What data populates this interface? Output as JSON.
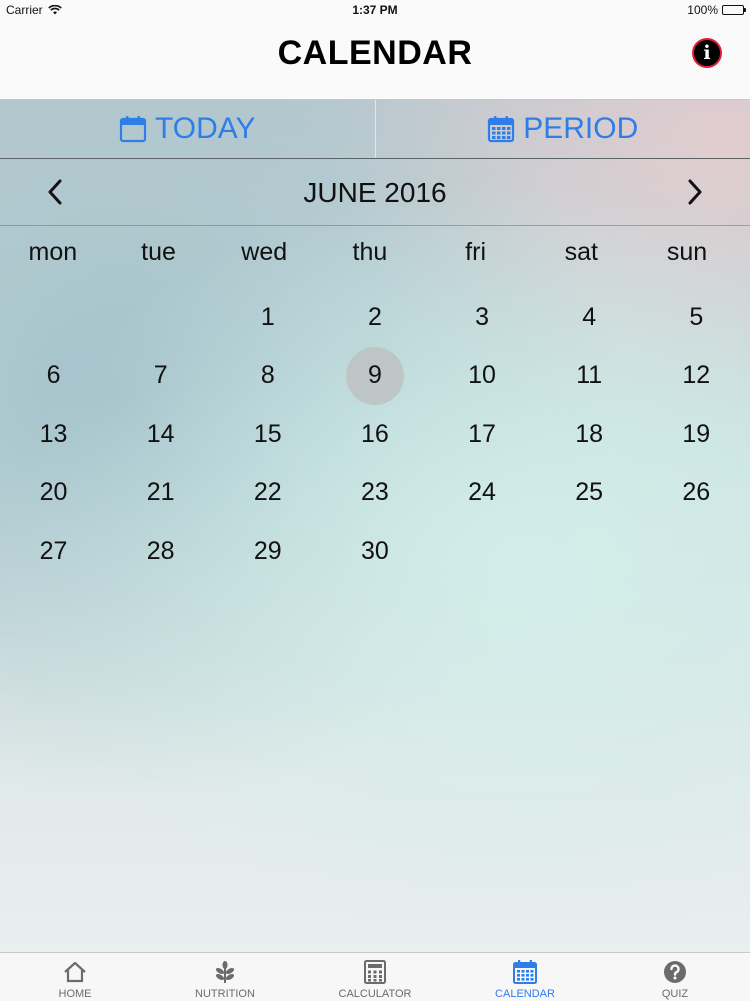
{
  "status_bar": {
    "carrier": "Carrier",
    "time": "1:37 PM",
    "battery": "100%"
  },
  "nav": {
    "title": "CALENDAR",
    "info_glyph": "i"
  },
  "segments": [
    {
      "label": "TODAY",
      "icon": "calendar-icon"
    },
    {
      "label": "PERIOD",
      "icon": "calendar-grid-icon"
    }
  ],
  "calendar": {
    "month_label": "JUNE 2016",
    "weekdays": [
      "mon",
      "tue",
      "wed",
      "thu",
      "fri",
      "sat",
      "sun"
    ],
    "leading_blanks": 2,
    "days": [
      "1",
      "2",
      "3",
      "4",
      "5",
      "6",
      "7",
      "8",
      "9",
      "10",
      "11",
      "12",
      "13",
      "14",
      "15",
      "16",
      "17",
      "18",
      "19",
      "20",
      "21",
      "22",
      "23",
      "24",
      "25",
      "26",
      "27",
      "28",
      "29",
      "30"
    ],
    "highlighted_day": "9"
  },
  "tab_bar": {
    "items": [
      {
        "label": "HOME",
        "icon": "home-icon",
        "active": false
      },
      {
        "label": "NUTRITION",
        "icon": "leaf-icon",
        "active": false
      },
      {
        "label": "CALCULATOR",
        "icon": "calculator-icon",
        "active": false
      },
      {
        "label": "CALENDAR",
        "icon": "calendar-icon",
        "active": true
      },
      {
        "label": "QUIZ",
        "icon": "question-icon",
        "active": false
      }
    ]
  },
  "colors": {
    "accent": "#2f7ee8",
    "highlight": "#bebebe",
    "info_border": "#e0203a"
  }
}
